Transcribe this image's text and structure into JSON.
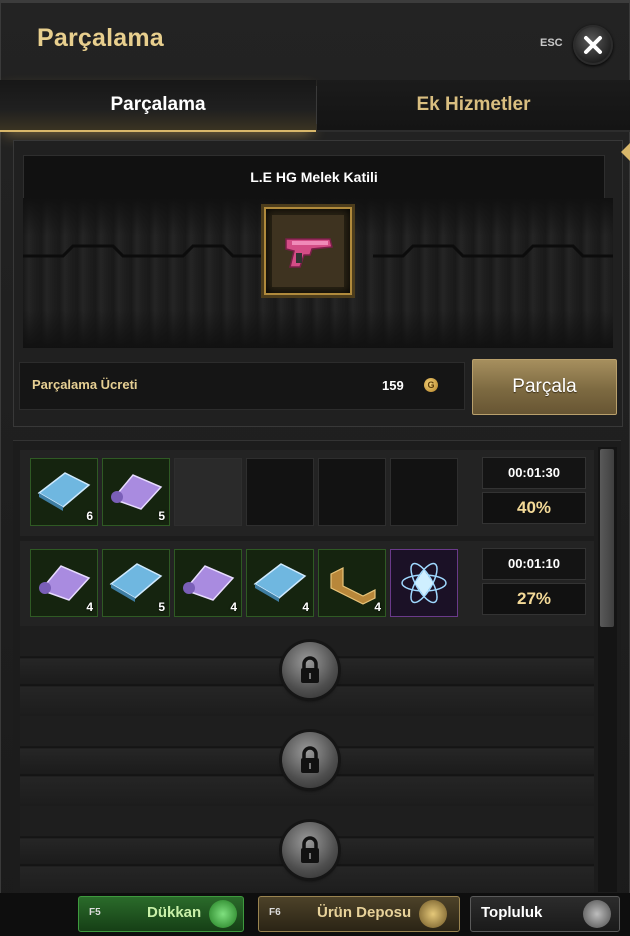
{
  "window": {
    "title": "Parçalama",
    "esc_label": "ESC"
  },
  "tabs": [
    {
      "label": "Parçalama",
      "active": true
    },
    {
      "label": "Ek Hizmetler",
      "active": false
    }
  ],
  "item": {
    "name": "L.E HG Melek Katili",
    "icon": "pink-handgun-icon"
  },
  "fee": {
    "label": "Parçalama Ücreti",
    "value": "159",
    "currency_icon": "gold-coin-icon",
    "coin_glyph": "G"
  },
  "action": {
    "label": "Parçala"
  },
  "queue": [
    {
      "time": "00:01:30",
      "percent": "40%",
      "slots": [
        {
          "icon": "blue-crystal-plate-icon",
          "qty": "6"
        },
        {
          "icon": "purple-scroll-icon",
          "qty": "5"
        }
      ]
    },
    {
      "time": "00:01:10",
      "percent": "27%",
      "slots": [
        {
          "icon": "purple-scroll-icon",
          "qty": "4"
        },
        {
          "icon": "blue-crystal-plate-icon",
          "qty": "5"
        },
        {
          "icon": "purple-scroll-icon",
          "qty": "4"
        },
        {
          "icon": "blue-crystal-plate-icon",
          "qty": "4"
        },
        {
          "icon": "gold-bracket-icon",
          "qty": "4"
        },
        {
          "icon": "atom-crystal-icon",
          "qty": ""
        }
      ]
    }
  ],
  "bottom": {
    "shop": {
      "key": "F5",
      "label": "Dükkan"
    },
    "depot": {
      "key": "F6",
      "label": "Ürün Deposu"
    },
    "community": {
      "label": "Topluluk"
    }
  },
  "colors": {
    "gold": "#e8cf8e",
    "accent": "#d8b76a",
    "progress_text": "#f3d997"
  }
}
